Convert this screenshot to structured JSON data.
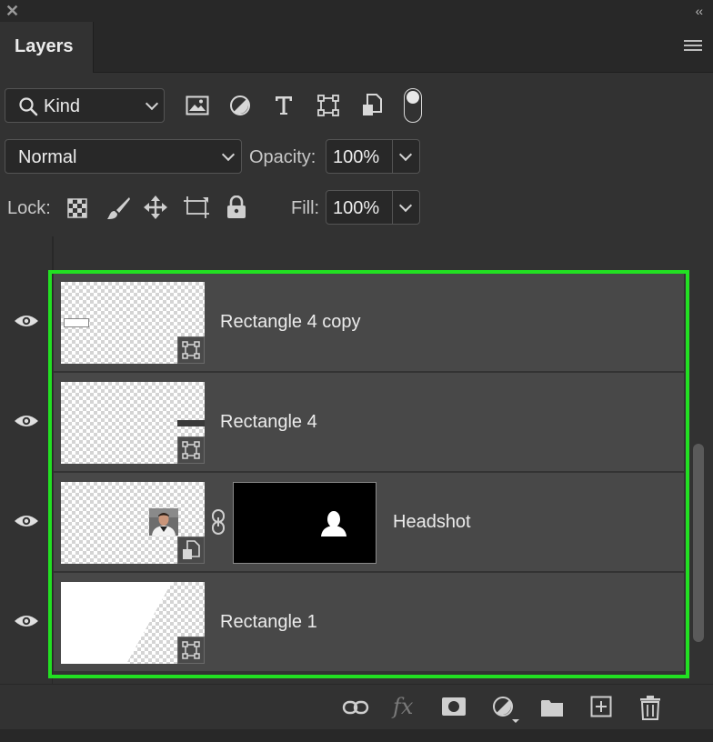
{
  "window": {
    "close_glyph": "✕",
    "collapse_glyph": "‹‹"
  },
  "tab": {
    "label": "Layers"
  },
  "filter": {
    "kind_label": "Kind"
  },
  "blend": {
    "mode": "Normal",
    "opacity_label": "Opacity:",
    "opacity_value": "100%"
  },
  "lock": {
    "label": "Lock:",
    "fill_label": "Fill:",
    "fill_value": "100%"
  },
  "layers": [
    {
      "name": "Rectangle 4 copy",
      "visible": true,
      "badge": "shape-icon"
    },
    {
      "name": "Rectangle 4",
      "visible": true,
      "badge": "shape-icon"
    },
    {
      "name": "Headshot",
      "visible": true,
      "badge": "smart-object-icon",
      "has_mask": true
    },
    {
      "name": "Rectangle 1",
      "visible": true,
      "badge": "shape-icon"
    }
  ],
  "bottom": {
    "fx_label": "fx"
  },
  "colors": {
    "highlight": "#22e022",
    "panel": "#323232",
    "layer_bg": "#484848"
  }
}
